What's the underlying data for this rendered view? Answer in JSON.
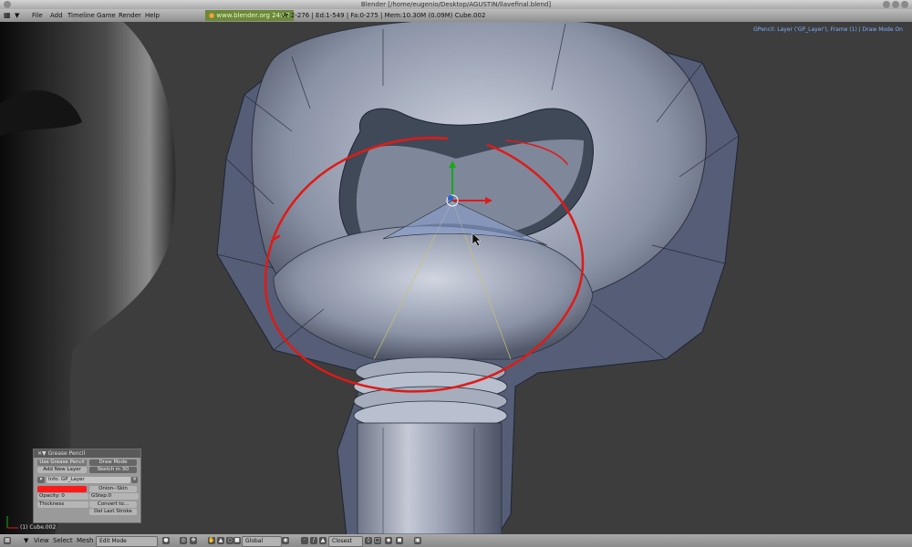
{
  "window": {
    "title": "Blender [/home/eugenio/Desktop/AGUSTIN/llavefinal.blend]"
  },
  "menu": {
    "items": [
      "File",
      "Add",
      "Timeline",
      "Game",
      "Render",
      "Help"
    ],
    "website": "www.blender.org 249.2",
    "stats": "Ve:2-276 | Ed:1-549 | Fa:0-275 | Mem:10.30M (0.09M) Cube.002"
  },
  "viewport": {
    "gpencil_status": "GPencil: Layer ('GP_Layer'), Frame (1) | Draw Mode On",
    "object_label": "(1) Cube.002",
    "stroke_color": "#e01a16",
    "bg_color": "#3d3d3d"
  },
  "grease_pencil_panel": {
    "title": "Grease Pencil",
    "use_button": "Use Grease Pencil",
    "draw_mode": "Draw Mode",
    "add_layer": "Add New Layer",
    "sketch_3d": "Sketch in 3D",
    "layer_name": "Info: GP_Layer",
    "onion_skin": "Onion--Skin",
    "opacity_label": "Opacity: 0",
    "gstep_label": "GStep:0",
    "thickness_label": "Thickness",
    "convert": "Convert to...",
    "del_last": "Del Last Stroke",
    "color": "#ff1a1a"
  },
  "bottombar": {
    "view": "View",
    "select": "Select",
    "mesh": "Mesh",
    "mode": "Edit Mode",
    "orientation": "Global",
    "snap": "Closest"
  }
}
